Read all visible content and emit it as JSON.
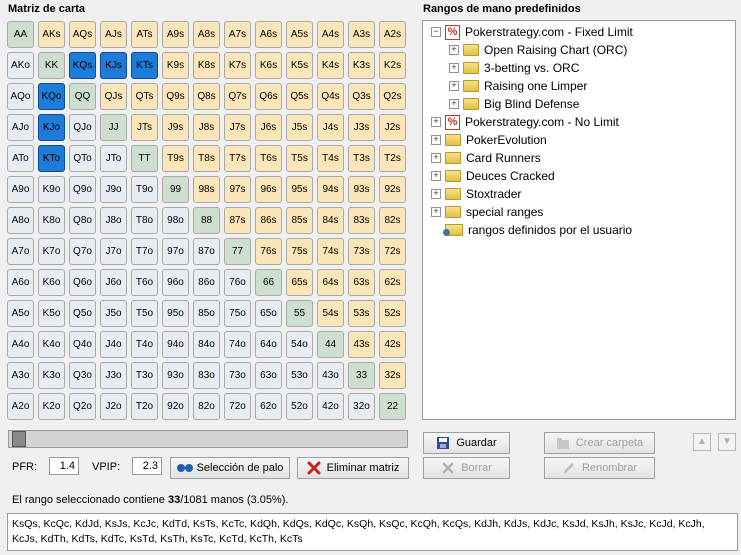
{
  "matrix": {
    "title": "Matriz de carta",
    "rows": [
      [
        "AA",
        "AKs",
        "AQs",
        "AJs",
        "ATs",
        "A9s",
        "A8s",
        "A7s",
        "A6s",
        "A5s",
        "A4s",
        "A3s",
        "A2s"
      ],
      [
        "AKo",
        "KK",
        "KQs",
        "KJs",
        "KTs",
        "K9s",
        "K8s",
        "K7s",
        "K6s",
        "K5s",
        "K4s",
        "K3s",
        "K2s"
      ],
      [
        "AQo",
        "KQo",
        "QQ",
        "QJs",
        "QTs",
        "Q9s",
        "Q8s",
        "Q7s",
        "Q6s",
        "Q5s",
        "Q4s",
        "Q3s",
        "Q2s"
      ],
      [
        "AJo",
        "KJo",
        "QJo",
        "JJ",
        "JTs",
        "J9s",
        "J8s",
        "J7s",
        "J6s",
        "J5s",
        "J4s",
        "J3s",
        "J2s"
      ],
      [
        "ATo",
        "KTo",
        "QTo",
        "JTo",
        "TT",
        "T9s",
        "T8s",
        "T7s",
        "T6s",
        "T5s",
        "T4s",
        "T3s",
        "T2s"
      ],
      [
        "A9o",
        "K9o",
        "Q9o",
        "J9o",
        "T9o",
        "99",
        "98s",
        "97s",
        "96s",
        "95s",
        "94s",
        "93s",
        "92s"
      ],
      [
        "A8o",
        "K8o",
        "Q8o",
        "J8o",
        "T8o",
        "98o",
        "88",
        "87s",
        "86s",
        "85s",
        "84s",
        "83s",
        "82s"
      ],
      [
        "A7o",
        "K7o",
        "Q7o",
        "J7o",
        "T7o",
        "97o",
        "87o",
        "77",
        "76s",
        "75s",
        "74s",
        "73s",
        "72s"
      ],
      [
        "A6o",
        "K6o",
        "Q6o",
        "J6o",
        "T6o",
        "96o",
        "86o",
        "76o",
        "66",
        "65s",
        "64s",
        "63s",
        "62s"
      ],
      [
        "A5o",
        "K5o",
        "Q5o",
        "J5o",
        "T5o",
        "95o",
        "85o",
        "75o",
        "65o",
        "55",
        "54s",
        "53s",
        "52s"
      ],
      [
        "A4o",
        "K4o",
        "Q4o",
        "J4o",
        "T4o",
        "94o",
        "84o",
        "74o",
        "64o",
        "54o",
        "44",
        "43s",
        "42s"
      ],
      [
        "A3o",
        "K3o",
        "Q3o",
        "J3o",
        "T3o",
        "93o",
        "83o",
        "73o",
        "63o",
        "53o",
        "43o",
        "33",
        "32s"
      ],
      [
        "A2o",
        "K2o",
        "Q2o",
        "J2o",
        "T2o",
        "92o",
        "82o",
        "72o",
        "62o",
        "52o",
        "42o",
        "32o",
        "22"
      ]
    ],
    "selected": [
      "KQs",
      "KJs",
      "KTs",
      "KQo",
      "KJo",
      "KTo"
    ]
  },
  "controls": {
    "pfr_label": "PFR:",
    "pfr_value": "1.4",
    "vpip_label": "VPIP:",
    "vpip_value": "2.3",
    "suit_button": "Selección de palo",
    "clear_button": "Eliminar matriz"
  },
  "ranges": {
    "title": "Rangos de mano predefinidos",
    "save": "Guardar",
    "create_folder": "Crear carpeta",
    "delete": "Borrar",
    "rename": "Renombrar",
    "tree": [
      {
        "label": "Pokerstrategy.com - Fixed Limit",
        "level": 0,
        "icon": "pokerstrategy",
        "expander": "−"
      },
      {
        "label": "Open Raising Chart (ORC)",
        "level": 1,
        "icon": "folder",
        "expander": "+"
      },
      {
        "label": "3-betting vs. ORC",
        "level": 1,
        "icon": "folder",
        "expander": "+"
      },
      {
        "label": "Raising one Limper",
        "level": 1,
        "icon": "folder",
        "expander": "+"
      },
      {
        "label": "Big Blind Defense",
        "level": 1,
        "icon": "folder",
        "expander": "+"
      },
      {
        "label": "Pokerstrategy.com - No Limit",
        "level": 0,
        "icon": "pokerstrategy",
        "expander": "+"
      },
      {
        "label": "PokerEvolution",
        "level": 0,
        "icon": "folder",
        "expander": "+"
      },
      {
        "label": "Card Runners",
        "level": 0,
        "icon": "folder",
        "expander": "+"
      },
      {
        "label": "Deuces Cracked",
        "level": 0,
        "icon": "folder",
        "expander": "+"
      },
      {
        "label": "Stoxtrader",
        "level": 0,
        "icon": "folder",
        "expander": "+"
      },
      {
        "label": "special ranges",
        "level": 0,
        "icon": "folder",
        "expander": "+"
      },
      {
        "label": "rangos definidos por el usuario",
        "level": 0,
        "icon": "user-folder",
        "expander": ""
      }
    ]
  },
  "summary": {
    "prefix": "El rango seleccionado contiene ",
    "count": "33",
    "suffix": "/1081 manos (3.05%)."
  },
  "combos": "KsQs, KcQc, KdJd, KsJs, KcJc, KdTd, KsTs, KcTc, KdQh, KdQs, KdQc, KsQh, KsQc, KcQh, KcQs, KdJh, KdJs, KdJc, KsJd, KsJh, KsJc, KcJd, KcJh, KcJs, KdTh, KdTs, KdTc, KsTd, KsTh, KsTc, KcTd, KcTh, KcTs"
}
